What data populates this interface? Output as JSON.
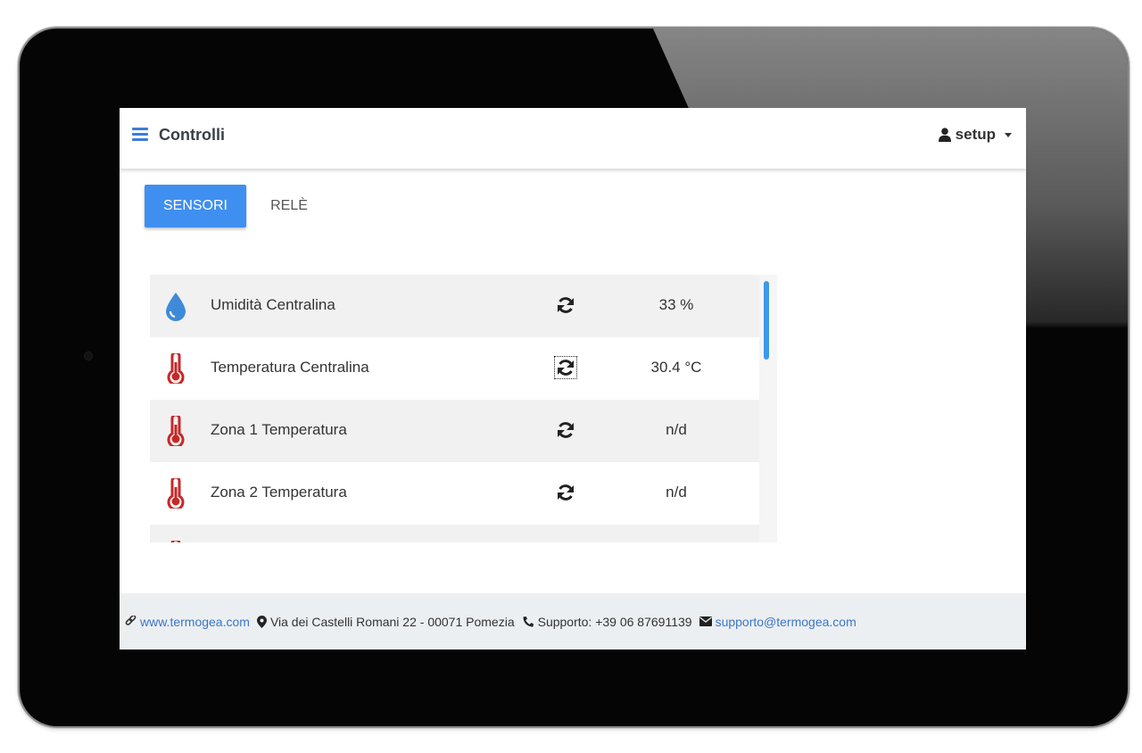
{
  "header": {
    "title": "Controlli",
    "user": "setup"
  },
  "tabs": [
    {
      "label": "SENSORI",
      "active": true
    },
    {
      "label": "RELÈ",
      "active": false
    }
  ],
  "sensors": [
    {
      "icon": "water-drop-icon",
      "name": "Umidità Centralina",
      "value": "33 %"
    },
    {
      "icon": "thermometer-icon",
      "name": "Temperatura Centralina",
      "value": "30.4 °C"
    },
    {
      "icon": "thermometer-icon",
      "name": "Zona 1 Temperatura",
      "value": "n/d"
    },
    {
      "icon": "thermometer-icon",
      "name": "Zona 2 Temperatura",
      "value": "n/d"
    }
  ],
  "footer": {
    "website": "www.termogea.com",
    "address": "Via dei Castelli Romani 22 - 00071 Pomezia",
    "support": "Supporto: +39 06 87691139",
    "email": "supporto@termogea.com"
  },
  "colors": {
    "accent": "#3f8ff0",
    "thermometer": "#c62828",
    "drop": "#3f8ad8",
    "scrollbar": "#3c9ae8"
  }
}
